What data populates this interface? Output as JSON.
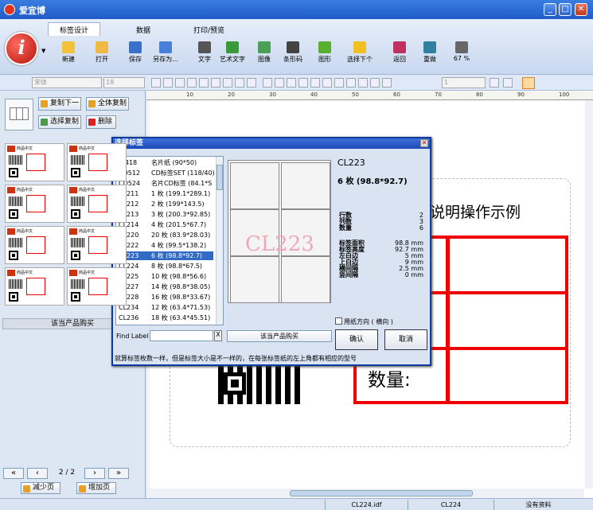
{
  "window": {
    "title": "爱宜博"
  },
  "ribbon": {
    "tabs": [
      {
        "label": "标签设计"
      },
      {
        "label": "数据"
      },
      {
        "label": "打印/预览"
      }
    ],
    "buttons": [
      {
        "label": "新建",
        "color": "#f2c23a"
      },
      {
        "label": "打开",
        "color": "#f0b844"
      },
      {
        "label": "保存",
        "color": "#3a70c8"
      },
      {
        "label": "另存为...",
        "color": "#4a7ed8"
      },
      {
        "label": "文字",
        "color": "#555555"
      },
      {
        "label": "艺术文字",
        "color": "#3a9a3a"
      },
      {
        "label": "图像",
        "color": "#4aa058"
      },
      {
        "label": "条形码",
        "color": "#444444"
      },
      {
        "label": "图形",
        "color": "#58b030"
      },
      {
        "label": "选择下个",
        "color": "#f0c020"
      },
      {
        "label": "返回",
        "color": "#c03060"
      },
      {
        "label": "重做",
        "color": "#3080a0"
      },
      {
        "label": "67 %",
        "color": "#666666"
      }
    ]
  },
  "formatbar": {
    "font": "宋体",
    "size": "18",
    "width": "1"
  },
  "left": {
    "copy_next": "复制下一",
    "copy_all": "全体复制",
    "select_copy": "选择复制",
    "delete": "删除",
    "buy": "该当产品购买",
    "thumb_caption": "商品中文",
    "page": "2 / 2",
    "reduce_page": "减少页",
    "add_page": "增加页"
  },
  "canvas": {
    "ruler_ticks": [
      "10",
      "20",
      "30",
      "40",
      "50",
      "60",
      "70",
      "80",
      "90",
      "100"
    ],
    "title": "说明操作示例",
    "qty": "数量:"
  },
  "dialog": {
    "title": "选择标签",
    "labels": [
      {
        "code": "BJ418",
        "desc": "名片纸 (90*50)"
      },
      {
        "code": "CD512",
        "desc": "CD标签SET (118/40)"
      },
      {
        "code": "CD524",
        "desc": "名片CD标签 (84.1*S"
      },
      {
        "code": "CL211",
        "desc": "1 枚 (199.1*289.1)"
      },
      {
        "code": "CL212",
        "desc": "2 枚 (199*143.5)"
      },
      {
        "code": "CL213",
        "desc": "3 枚 (200.3*92.85)"
      },
      {
        "code": "CL214",
        "desc": "4 枚 (201.5*67.7)"
      },
      {
        "code": "CL220",
        "desc": "20 枚 (83.9*28.03)"
      },
      {
        "code": "CL222",
        "desc": "4 枚 (99.5*138.2)"
      },
      {
        "code": "CL223",
        "desc": "6 枚 (98.8*92.7)",
        "selected": true
      },
      {
        "code": "CL224",
        "desc": "8 枚 (98.8*67.5)"
      },
      {
        "code": "CL225",
        "desc": "10 枚 (98.8*56.6)"
      },
      {
        "code": "CL227",
        "desc": "14 枚 (98.8*38.05)"
      },
      {
        "code": "CL228",
        "desc": "16 枚 (98.8*33.67)"
      },
      {
        "code": "CL234",
        "desc": "12 枚 (63.4*71.53)"
      },
      {
        "code": "CL236",
        "desc": "18 枚 (63.4*45.51)"
      }
    ],
    "find_label": "Find Label",
    "clear": "X",
    "buy": "该当产品购买",
    "watermark": "CL223",
    "code": "CL223",
    "count": "6 枚 (98.8*92.7)",
    "specs": [
      {
        "label": "行数",
        "value": "2"
      },
      {
        "label": "列数",
        "value": "3"
      },
      {
        "label": "数量",
        "value": "6"
      },
      {
        "label": "标签面积",
        "value": "98.8 mm"
      },
      {
        "label": "标签高度",
        "value": "92.7 mm"
      },
      {
        "label": "左白边",
        "value": "5 mm"
      },
      {
        "label": "上白边",
        "value": "9 mm"
      },
      {
        "label": "横间隔",
        "value": "2.5 mm"
      },
      {
        "label": "竖间隔",
        "value": "0 mm"
      }
    ],
    "orientation": "用纸方向 ( 横向 )",
    "ok": "确认",
    "cancel": "取消",
    "hint": "就算标签枚数一样，但是标签大小是不一样的，在每张标签纸的左上角都有相应的型号"
  },
  "status": {
    "file": "CL224.idf",
    "label": "CL224",
    "data": "没有资料"
  }
}
